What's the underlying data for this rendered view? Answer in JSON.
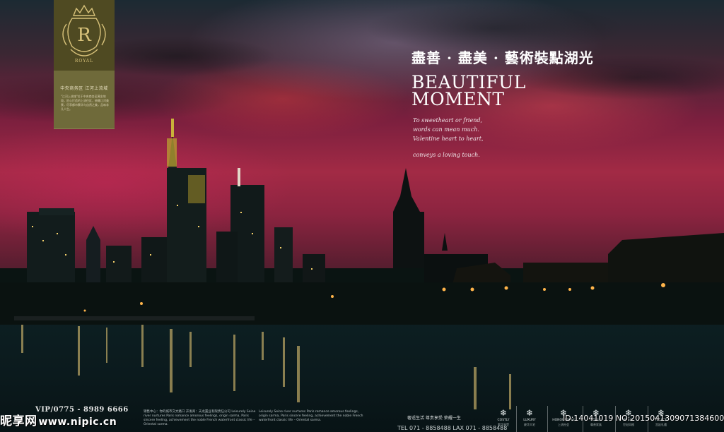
{
  "logo": {
    "brand": "ROYAL",
    "letter": "R",
    "subtitle": "中央商务区 江河上流域",
    "body_text": "\"江河上流域\"位于中央商务区黄金地段，匠心打造的上流住区，俯瞰江河美景，尽享都市繁华与自然之美，品味非凡人生。"
  },
  "headline": "盡善 · 盡美 ·   藝術裝點湖光",
  "title": {
    "line1": "BEAUTIFUL",
    "line2": "MOMENT"
  },
  "poem": {
    "line1": "To sweetheart or friend,",
    "line2": "words can mean much.",
    "line3": "Valentine heart to heart,",
    "line4": "conveys a loving touch."
  },
  "footer": {
    "vip": "VIP/0775 - 8989 6666",
    "watermark_cn": "昵享网",
    "watermark_url": "www.nipic.cn",
    "info1": "销售中心：你的城市交文路口 开发商：天龙置业有限责任公司 Leisurely Seine river nurtures Paris romance amorous feelings, origin sarma, Paris sincere feeling, achievement the noble French waterfront classic life – Oriental sarma.",
    "info2": "Leisurely Seine river nurtures Paris romance amorous feelings, origin sarma, Paris sincere feeling, achievement the noble French waterfront classic life – Oriental sarma.",
    "tagline": "奢适生活  尊贵享受  荣耀一生",
    "tel": "TEL 071 - 8858488   LAX 071 - 8858488",
    "id_text": "ID:14041019 NO:20150413090713846000"
  },
  "icons": [
    {
      "label": "COSTLY",
      "sub": "奢华享受",
      "icon": "snowflake-icon"
    },
    {
      "label": "LUXURY",
      "sub": "豪华大宅",
      "icon": "snowflake-icon"
    },
    {
      "label": "HONOURABLE",
      "sub": "上流社会",
      "icon": "snowflake-icon"
    },
    {
      "label": "NOBLE",
      "sub": "尊贵家族",
      "icon": "snowflake-icon"
    },
    {
      "label": "STYLE",
      "sub": "世纪风格",
      "icon": "snowflake-icon"
    },
    {
      "label": "PALACE",
      "sub": "宫廷礼遇",
      "icon": "snowflake-icon"
    }
  ],
  "colors": {
    "sky_red": "#a22a45",
    "water": "#0b1a1d",
    "logo_panel": "#6f6a3a",
    "logo_gold": "#d8c27a"
  }
}
